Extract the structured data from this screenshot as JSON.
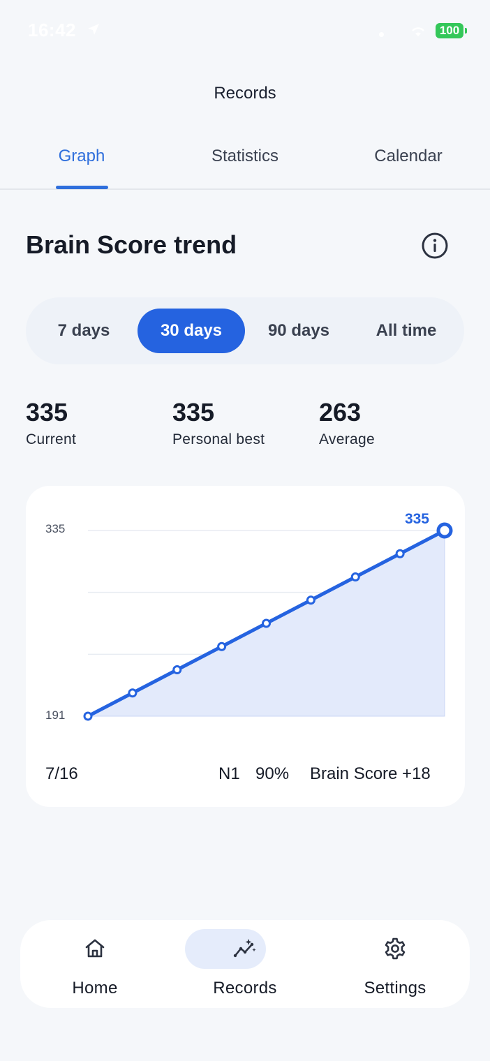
{
  "status_bar": {
    "time": "16:42",
    "battery": "100"
  },
  "header": {
    "title": "Records"
  },
  "tabs": [
    {
      "label": "Graph",
      "active": true
    },
    {
      "label": "Statistics",
      "active": false
    },
    {
      "label": "Calendar",
      "active": false
    }
  ],
  "section": {
    "title": "Brain Score trend"
  },
  "ranges": [
    {
      "label": "7 days",
      "active": false
    },
    {
      "label": "30 days",
      "active": true
    },
    {
      "label": "90 days",
      "active": false
    },
    {
      "label": "All time",
      "active": false
    }
  ],
  "stats": [
    {
      "value": "335",
      "label": "Current"
    },
    {
      "value": "335",
      "label": "Personal best"
    },
    {
      "value": "263",
      "label": "Average"
    }
  ],
  "chart_data": {
    "type": "area",
    "y_tick_labels": [
      "335",
      "191"
    ],
    "ylim": [
      191,
      335
    ],
    "values": [
      191,
      209,
      227,
      245,
      263,
      281,
      299,
      317,
      335
    ],
    "last_point_label": "335",
    "grid": true,
    "colors": {
      "line": "#2563e0",
      "fill": "#e3eafb",
      "grid": "#e8ecf2"
    }
  },
  "card_footer": {
    "date": "7/16",
    "level": "N1",
    "accuracy": "90%",
    "delta": "Brain Score +18"
  },
  "bottom_nav": [
    {
      "label": "Home",
      "icon": "home-icon",
      "active": false
    },
    {
      "label": "Records",
      "icon": "trend-sparkle-icon",
      "active": true
    },
    {
      "label": "Settings",
      "icon": "gear-icon",
      "active": false
    }
  ],
  "colors": {
    "accent": "#2563e0",
    "background": "#f5f7fa",
    "battery": "#34c759"
  }
}
